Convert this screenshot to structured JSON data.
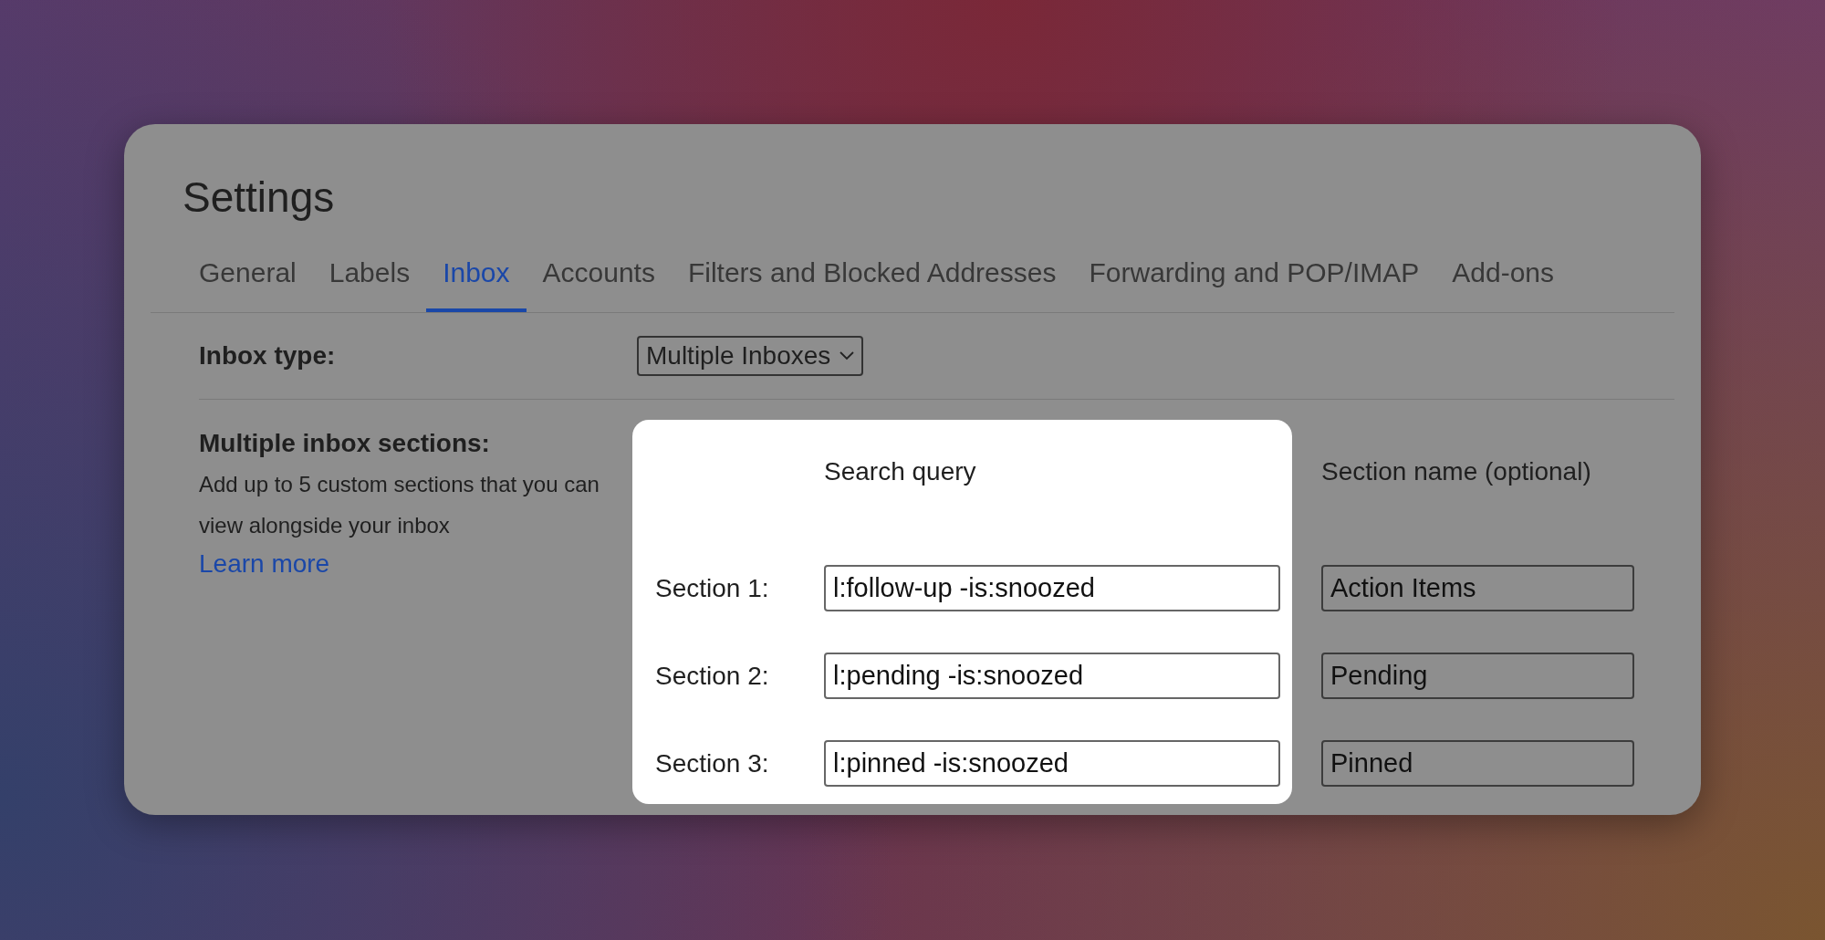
{
  "title": "Settings",
  "tabs": [
    {
      "label": "General",
      "selected": false
    },
    {
      "label": "Labels",
      "selected": false
    },
    {
      "label": "Inbox",
      "selected": true
    },
    {
      "label": "Accounts",
      "selected": false
    },
    {
      "label": "Filters and Blocked Addresses",
      "selected": false
    },
    {
      "label": "Forwarding and POP/IMAP",
      "selected": false
    },
    {
      "label": "Add-ons",
      "selected": false
    }
  ],
  "inbox_type": {
    "label": "Inbox type:",
    "value": "Multiple Inboxes"
  },
  "sections": {
    "heading": "Multiple inbox sections:",
    "description": "Add up to 5 custom sections that you can view alongside your inbox",
    "link": "Learn more",
    "query_header": "Search query",
    "name_header": "Section name (optional)",
    "rows": [
      {
        "label": "Section 1:",
        "query": "l:follow-up -is:snoozed",
        "name": "Action Items"
      },
      {
        "label": "Section 2:",
        "query": "l:pending -is:snoozed",
        "name": "Pending"
      },
      {
        "label": "Section 3:",
        "query": "l:pinned -is:snoozed",
        "name": "Pinned"
      }
    ]
  }
}
